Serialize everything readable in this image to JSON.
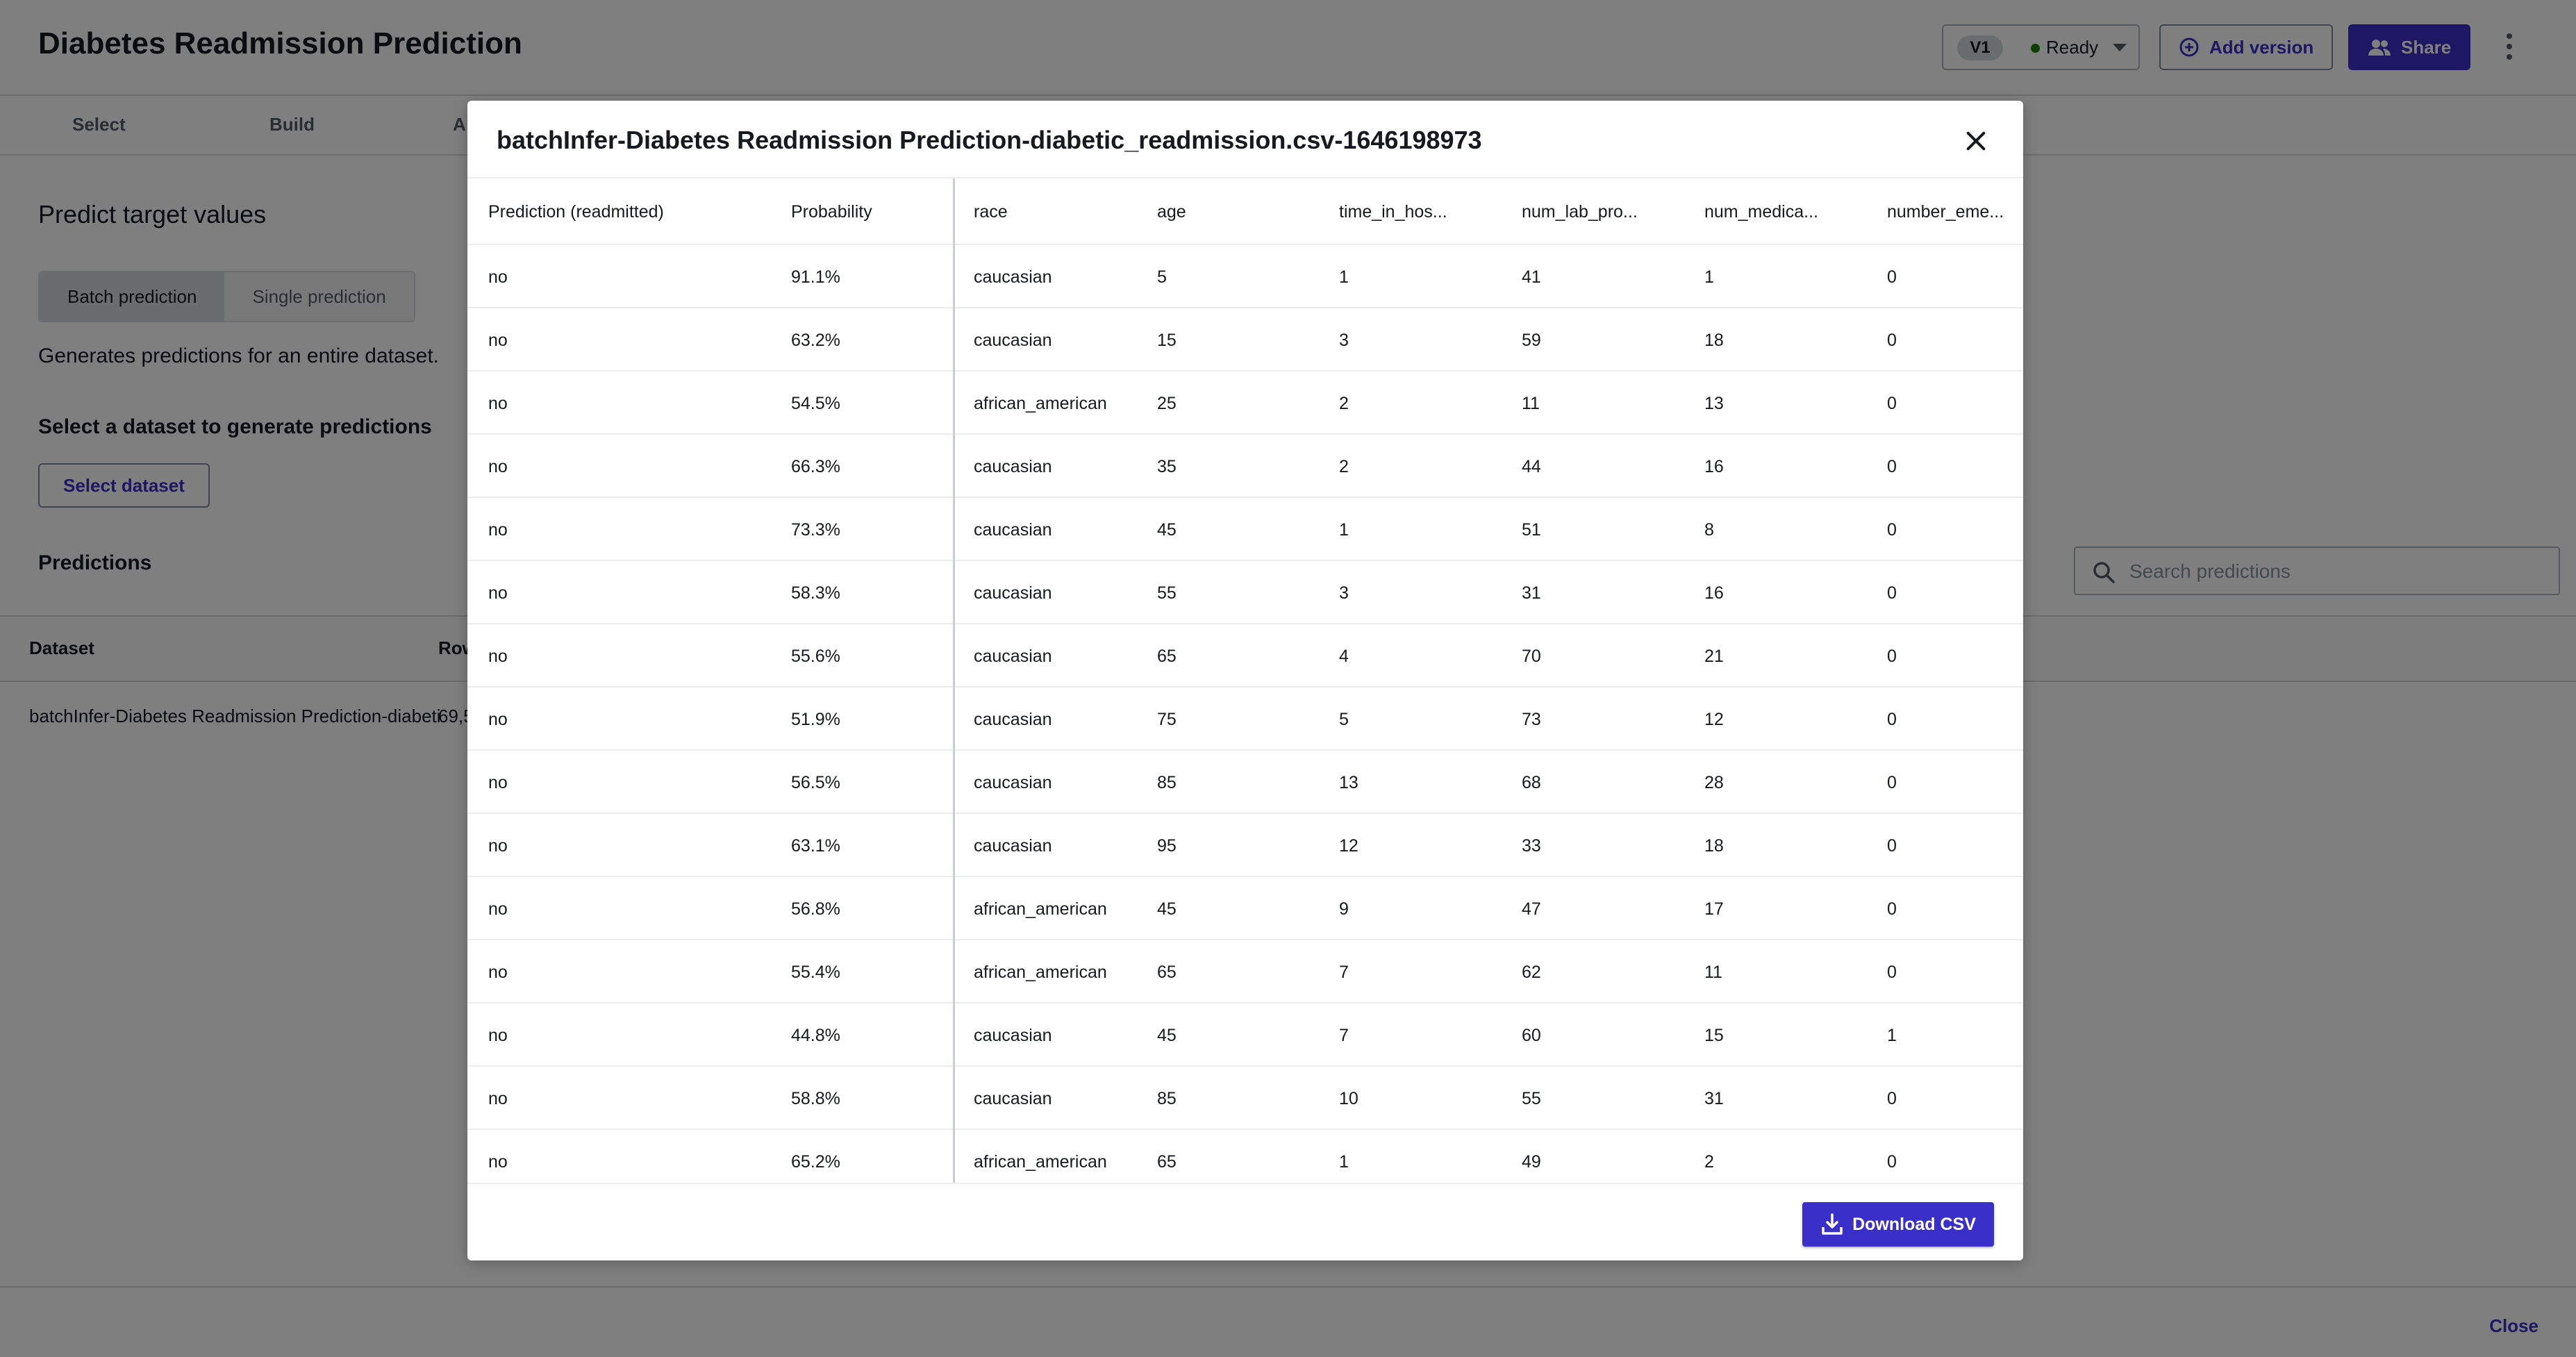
{
  "app": {
    "title": "Diabetes Readmission Prediction",
    "version": {
      "badge": "V1",
      "status": "Ready",
      "status_color": "#1d8102"
    },
    "add_version_label": "Add version",
    "share_label": "Share",
    "tabs": [
      "Select",
      "Build",
      "A"
    ],
    "section_title": "Predict target values",
    "mode_toggle": {
      "batch": "Batch prediction",
      "single": "Single prediction",
      "selected": "batch"
    },
    "description": "Generates predictions for an entire dataset.",
    "dataset_prompt": "Select a dataset to generate predictions",
    "select_dataset_label": "Select dataset",
    "predictions_title": "Predictions",
    "search_placeholder": "Search predictions",
    "table_headers": {
      "dataset": "Dataset",
      "rows": "Row"
    },
    "table_row": {
      "dataset": "batchInfer-Diabetes Readmission Prediction-diabeti",
      "rows": "69,5"
    },
    "close_label": "Close"
  },
  "modal": {
    "title": "batchInfer-Diabetes Readmission Prediction-diabetic_readmission.csv-1646198973",
    "columns": [
      "Prediction (readmitted)",
      "Probability",
      "race",
      "age",
      "time_in_hos...",
      "num_lab_pro...",
      "num_medica...",
      "number_eme..."
    ],
    "rows": [
      [
        "no",
        "91.1%",
        "caucasian",
        "5",
        "1",
        "41",
        "1",
        "0"
      ],
      [
        "no",
        "63.2%",
        "caucasian",
        "15",
        "3",
        "59",
        "18",
        "0"
      ],
      [
        "no",
        "54.5%",
        "african_american",
        "25",
        "2",
        "11",
        "13",
        "0"
      ],
      [
        "no",
        "66.3%",
        "caucasian",
        "35",
        "2",
        "44",
        "16",
        "0"
      ],
      [
        "no",
        "73.3%",
        "caucasian",
        "45",
        "1",
        "51",
        "8",
        "0"
      ],
      [
        "no",
        "58.3%",
        "caucasian",
        "55",
        "3",
        "31",
        "16",
        "0"
      ],
      [
        "no",
        "55.6%",
        "caucasian",
        "65",
        "4",
        "70",
        "21",
        "0"
      ],
      [
        "no",
        "51.9%",
        "caucasian",
        "75",
        "5",
        "73",
        "12",
        "0"
      ],
      [
        "no",
        "56.5%",
        "caucasian",
        "85",
        "13",
        "68",
        "28",
        "0"
      ],
      [
        "no",
        "63.1%",
        "caucasian",
        "95",
        "12",
        "33",
        "18",
        "0"
      ],
      [
        "no",
        "56.8%",
        "african_american",
        "45",
        "9",
        "47",
        "17",
        "0"
      ],
      [
        "no",
        "55.4%",
        "african_american",
        "65",
        "7",
        "62",
        "11",
        "0"
      ],
      [
        "no",
        "44.8%",
        "caucasian",
        "45",
        "7",
        "60",
        "15",
        "1"
      ],
      [
        "no",
        "58.8%",
        "caucasian",
        "85",
        "10",
        "55",
        "31",
        "0"
      ],
      [
        "no",
        "65.2%",
        "african_american",
        "65",
        "1",
        "49",
        "2",
        "0"
      ]
    ],
    "download_label": "Download CSV"
  },
  "colors": {
    "accent": "#3b2fc9",
    "overlay": "rgba(0,0,0,0.5)"
  },
  "icons": [
    "add-circle-icon",
    "users-icon",
    "more-vertical-icon",
    "search-icon",
    "close-icon",
    "download-icon",
    "chevron-down-icon"
  ]
}
